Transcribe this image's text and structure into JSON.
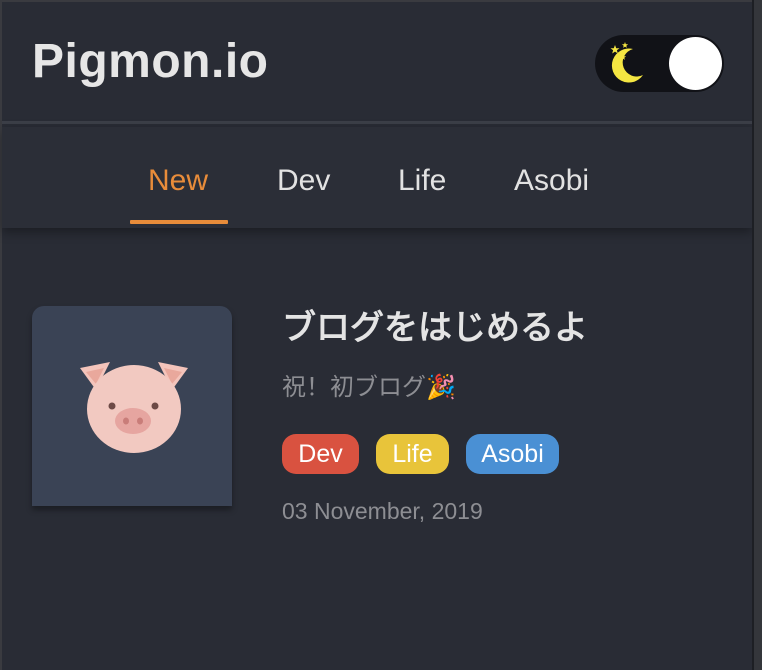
{
  "site": {
    "title": "Pigmon.io"
  },
  "theme_toggle": {
    "icon": "moon-stars-icon",
    "state": "dark"
  },
  "nav": {
    "tabs": [
      {
        "label": "New",
        "active": true
      },
      {
        "label": "Dev",
        "active": false
      },
      {
        "label": "Life",
        "active": false
      },
      {
        "label": "Asobi",
        "active": false
      }
    ]
  },
  "posts": [
    {
      "thumbnail_icon": "pig-icon",
      "title": "ブログをはじめるよ",
      "description": "祝！初ブログ🎉",
      "tags": [
        {
          "label": "Dev",
          "color": "#d95240"
        },
        {
          "label": "Life",
          "color": "#e8c43a"
        },
        {
          "label": "Asobi",
          "color": "#4a90d4"
        }
      ],
      "date": "03 November, 2019"
    }
  ],
  "colors": {
    "background": "#292c35",
    "accent": "#e88c3a",
    "text": "#e4e4e4",
    "muted": "#8d8e93"
  }
}
